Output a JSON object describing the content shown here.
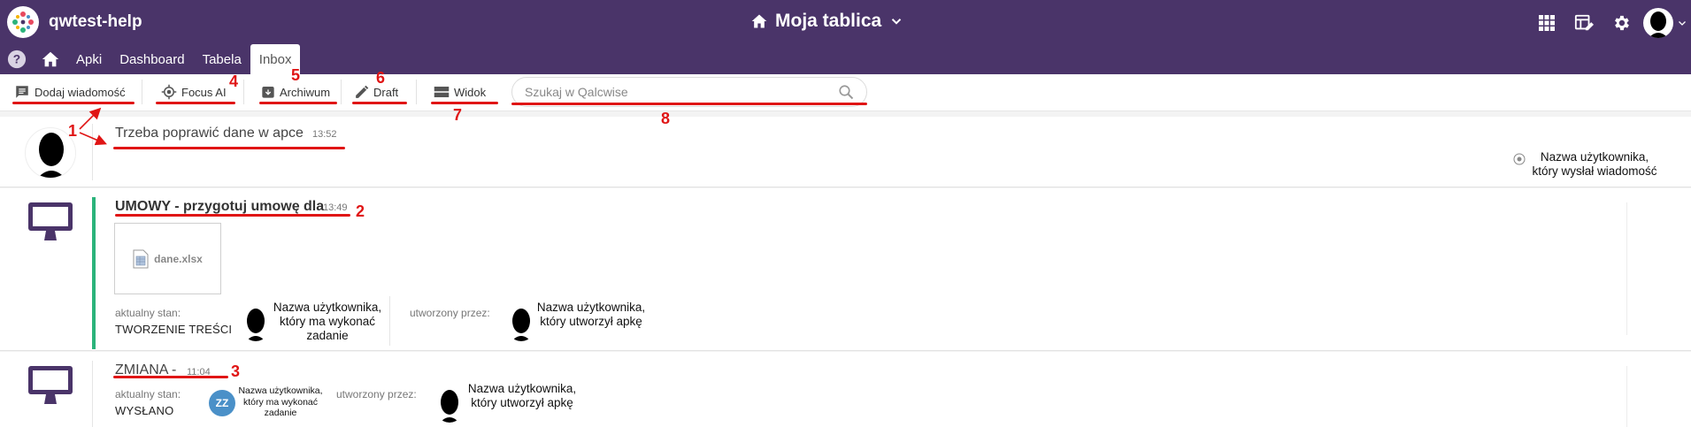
{
  "header": {
    "app_name": "qwtest-help",
    "board_title": "Moja tablica"
  },
  "nav_tabs": [
    {
      "label": "Apki"
    },
    {
      "label": "Dashboard"
    },
    {
      "label": "Tabela"
    },
    {
      "label": "Inbox",
      "active": true
    }
  ],
  "toolbar": {
    "add_message": "Dodaj wiadomość",
    "focus_ai": "Focus AI",
    "archive": "Archiwum",
    "draft": "Draft",
    "view": "Widok",
    "search_placeholder": "Szukaj w Qalcwise"
  },
  "annotations": [
    "1",
    "2",
    "3",
    "4",
    "5",
    "6",
    "7",
    "8"
  ],
  "messages": [
    {
      "title": "Trzeba poprawić dane w apce",
      "time": "13:52",
      "sender_note_line1": "Nazwa użytkownika,",
      "sender_note_line2": "który wysłał wiadomość"
    },
    {
      "title": "UMOWY - przygotuj umowę dla",
      "time": "13:49",
      "attachment": "dane.xlsx",
      "state_label": "aktualny stan:",
      "state_value": "TWORZENIE TREŚCI",
      "assignee_line1": "Nazwa użytkownika,",
      "assignee_line2": "który ma wykonać",
      "assignee_line3": "zadanie",
      "creator_label": "utworzony przez:",
      "creator_line1": "Nazwa użytkownika,",
      "creator_line2": "który utworzył apkę"
    },
    {
      "title": "ZMIANA -",
      "time": "11:04",
      "state_label": "aktualny stan:",
      "state_value": "WYSŁANO",
      "assignee_initials": "ZZ",
      "assignee_line1": "Nazwa użytkownika,",
      "assignee_line2": "który ma wykonać",
      "assignee_line3": "zadanie",
      "creator_label": "utworzony przez:",
      "creator_line1": "Nazwa użytkownika,",
      "creator_line2": "który utworzył apkę"
    }
  ],
  "colors": {
    "header_bg": "#4a3469",
    "accent_green": "#2bb37b",
    "annotation_red": "#e01515",
    "zz_avatar": "#4a90c8"
  }
}
